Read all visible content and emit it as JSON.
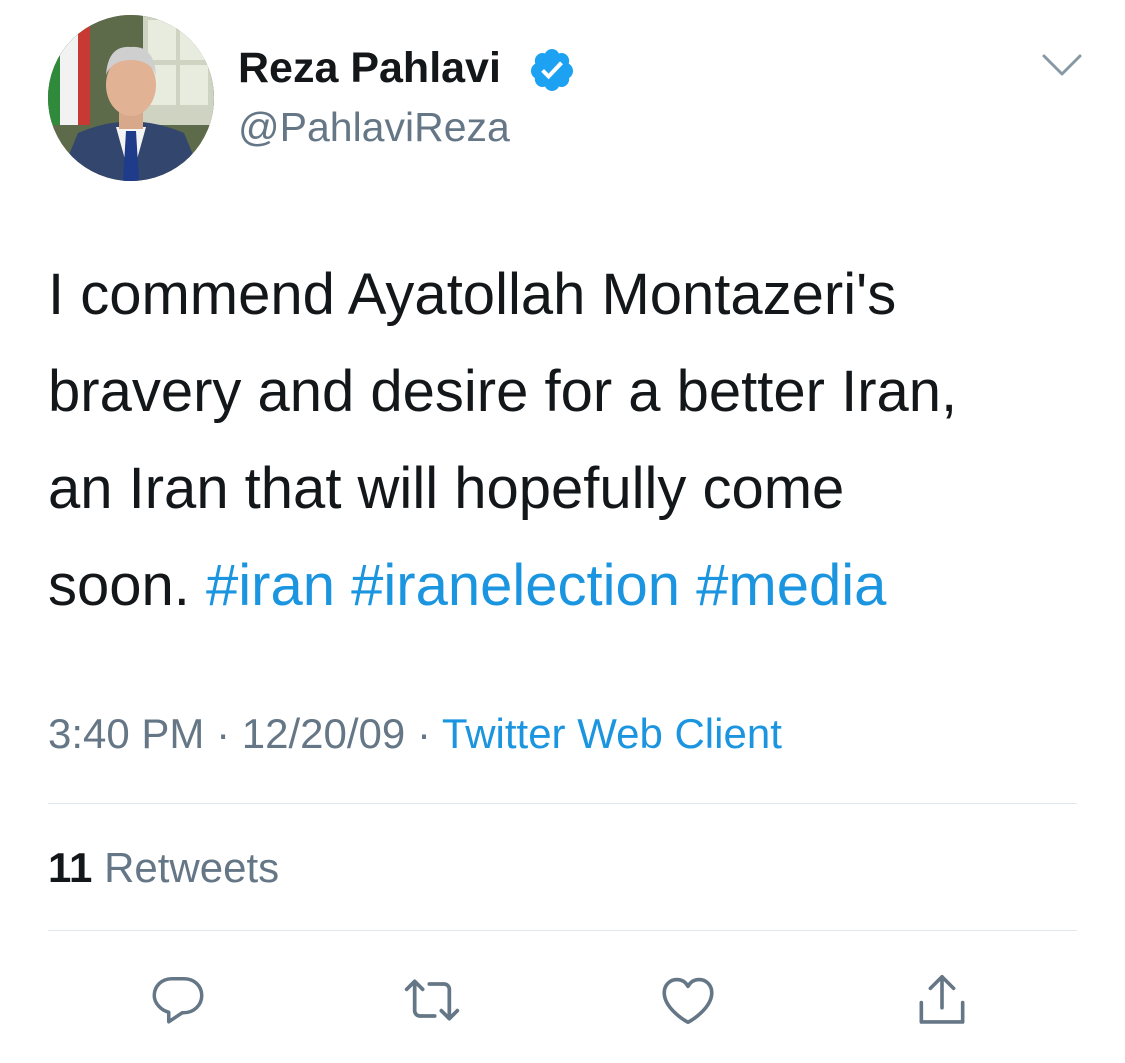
{
  "author": {
    "display_name": "Reza Pahlavi",
    "handle": "@PahlaviReza",
    "verified_icon": "verified-badge-icon",
    "avatar": "profile-photo"
  },
  "menu_icon": "chevron-down-icon",
  "tweet": {
    "line1": "I commend Ayatollah Montazeri's",
    "line2": "bravery and desire for a better Iran,",
    "line3": "an Iran that will hopefully come",
    "line4_text": "soon.",
    "hashtags": [
      "#iran",
      "#iranelection",
      "#media"
    ]
  },
  "meta": {
    "time": "3:40 PM",
    "separator": "·",
    "date": "12/20/09",
    "source": "Twitter Web Client"
  },
  "stats": {
    "retweet_count": "11",
    "retweet_label": "Retweets"
  },
  "actions": [
    {
      "name": "reply",
      "icon": "reply-icon"
    },
    {
      "name": "retweet",
      "icon": "retweet-icon"
    },
    {
      "name": "like",
      "icon": "heart-icon"
    },
    {
      "name": "share",
      "icon": "share-icon"
    }
  ],
  "colors": {
    "text": "#14171a",
    "secondary": "#657786",
    "link": "#1b95e0",
    "verified": "#1da1f2",
    "divider": "#e1e8ed"
  }
}
